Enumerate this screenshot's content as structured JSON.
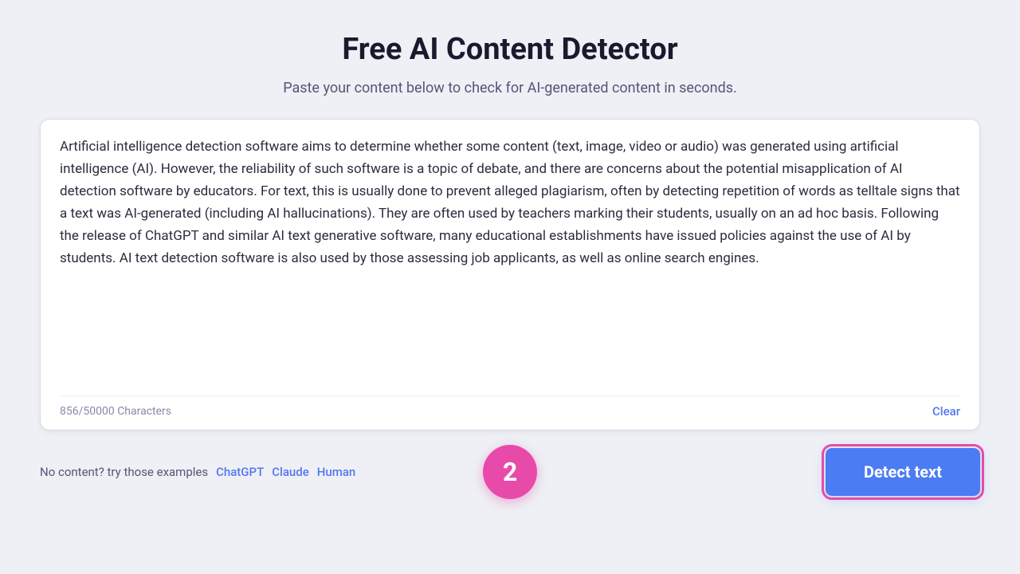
{
  "page": {
    "title": "Free AI Content Detector",
    "subtitle": "Paste your content below to check for AI-generated content in seconds.",
    "textarea": {
      "content": "Artificial intelligence detection software aims to determine whether some content (text, image, video or audio) was generated using artificial intelligence (AI). However, the reliability of such software is a topic of debate, and there are concerns about the potential misapplication of AI detection software by educators. For text, this is usually done to prevent alleged plagiarism, often by detecting repetition of words as telltale signs that a text was AI-generated (including AI hallucinations). They are often used by teachers marking their students, usually on an ad hoc basis. Following the release of ChatGPT and similar AI text generative software, many educational establishments have issued policies against the use of AI by students. AI text detection software is also used by those assessing job applicants, as well as online search engines.",
      "char_count": "856/50000 Characters",
      "clear_label": "Clear"
    },
    "bottom_bar": {
      "no_content_label": "No content? try those examples",
      "examples": [
        {
          "label": "ChatGPT"
        },
        {
          "label": "Claude"
        },
        {
          "label": "Human"
        }
      ],
      "step_badge": "2",
      "detect_button_label": "Detect text"
    }
  }
}
